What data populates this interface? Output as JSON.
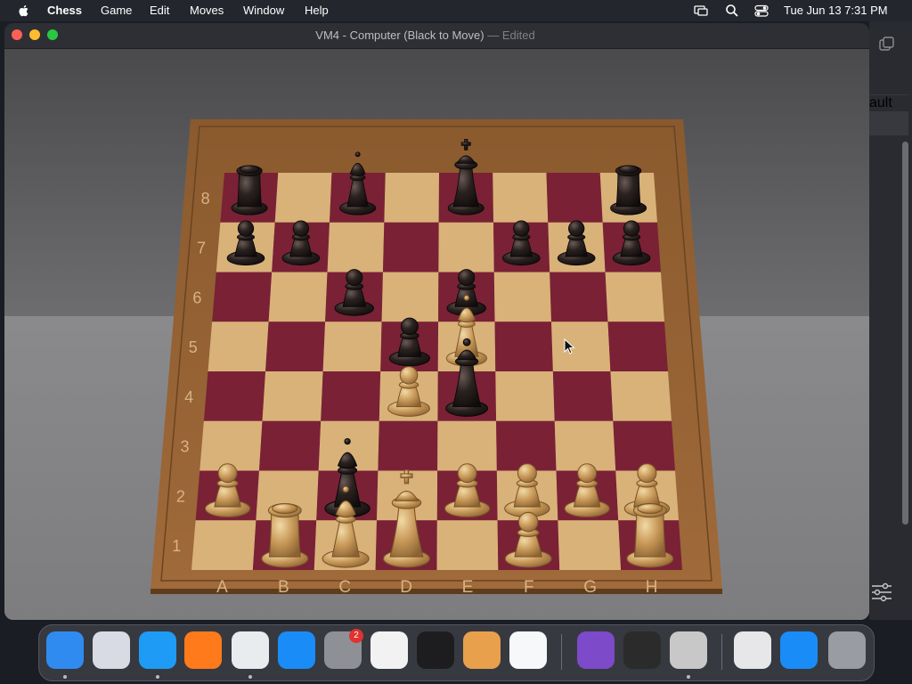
{
  "menubar": {
    "app_name": "Chess",
    "menus": [
      "Game",
      "Edit",
      "Moves",
      "Window",
      "Help"
    ],
    "clock": "Tue Jun 13  7:31 PM"
  },
  "window": {
    "title": "VM4 - Computer   (Black to Move)",
    "title_sep": "—",
    "status": "Edited"
  },
  "side_button_label": "ault",
  "board": {
    "files": [
      "A",
      "B",
      "C",
      "D",
      "E",
      "F",
      "G",
      "H"
    ],
    "ranks": [
      "1",
      "2",
      "3",
      "4",
      "5",
      "6",
      "7",
      "8"
    ],
    "pieces": [
      {
        "sq": "a8",
        "color": "black",
        "type": "rook"
      },
      {
        "sq": "c8",
        "color": "black",
        "type": "bishop"
      },
      {
        "sq": "e8",
        "color": "black",
        "type": "king"
      },
      {
        "sq": "h8",
        "color": "black",
        "type": "rook"
      },
      {
        "sq": "a7",
        "color": "black",
        "type": "pawn"
      },
      {
        "sq": "b7",
        "color": "black",
        "type": "pawn"
      },
      {
        "sq": "f7",
        "color": "black",
        "type": "pawn"
      },
      {
        "sq": "g7",
        "color": "black",
        "type": "pawn"
      },
      {
        "sq": "h7",
        "color": "black",
        "type": "pawn"
      },
      {
        "sq": "c6",
        "color": "black",
        "type": "pawn"
      },
      {
        "sq": "e6",
        "color": "black",
        "type": "pawn"
      },
      {
        "sq": "d5",
        "color": "black",
        "type": "pawn"
      },
      {
        "sq": "e5",
        "color": "white",
        "type": "bishop"
      },
      {
        "sq": "d4",
        "color": "white",
        "type": "pawn"
      },
      {
        "sq": "e4",
        "color": "black",
        "type": "queen"
      },
      {
        "sq": "c2",
        "color": "black",
        "type": "bishop"
      },
      {
        "sq": "a2",
        "color": "white",
        "type": "pawn"
      },
      {
        "sq": "e2",
        "color": "white",
        "type": "pawn"
      },
      {
        "sq": "f2",
        "color": "white",
        "type": "pawn"
      },
      {
        "sq": "g2",
        "color": "white",
        "type": "pawn"
      },
      {
        "sq": "h2",
        "color": "white",
        "type": "pawn"
      },
      {
        "sq": "b1",
        "color": "white",
        "type": "rook"
      },
      {
        "sq": "c1",
        "color": "white",
        "type": "bishop"
      },
      {
        "sq": "d1",
        "color": "white",
        "type": "king"
      },
      {
        "sq": "f1",
        "color": "white",
        "type": "pawn"
      },
      {
        "sq": "h1",
        "color": "white",
        "type": "rook"
      }
    ]
  },
  "dock": {
    "apps": [
      {
        "name": "Finder",
        "color": "#2f8bf0"
      },
      {
        "name": "Launchpad",
        "color": "#d8dbe3"
      },
      {
        "name": "Safari",
        "color": "#1e9bf5"
      },
      {
        "name": "Firefox",
        "color": "#ff7a1a"
      },
      {
        "name": "Chrome",
        "color": "#e9ecef"
      },
      {
        "name": "App Store",
        "color": "#1a8cf7"
      },
      {
        "name": "System Settings",
        "color": "#8e9096"
      },
      {
        "name": "TextEdit",
        "color": "#f2f2f2"
      },
      {
        "name": "Terminal",
        "color": "#1d1d1f"
      },
      {
        "name": "GarageBand",
        "color": "#e8a04c"
      },
      {
        "name": "Visual Studio Code",
        "color": "#f6f8fa"
      },
      {
        "name": "Visual Studio",
        "color": "#7d4ac9"
      },
      {
        "name": "Piano",
        "color": "#2b2b2b"
      },
      {
        "name": "Chess",
        "color": "#c8c8c8"
      },
      {
        "name": "Chrome Window",
        "color": "#e7e7ea"
      },
      {
        "name": "App Store Downloads",
        "color": "#1a8cf7"
      },
      {
        "name": "Trash",
        "color": "#9a9ca3"
      }
    ],
    "settings_badge": "2"
  }
}
